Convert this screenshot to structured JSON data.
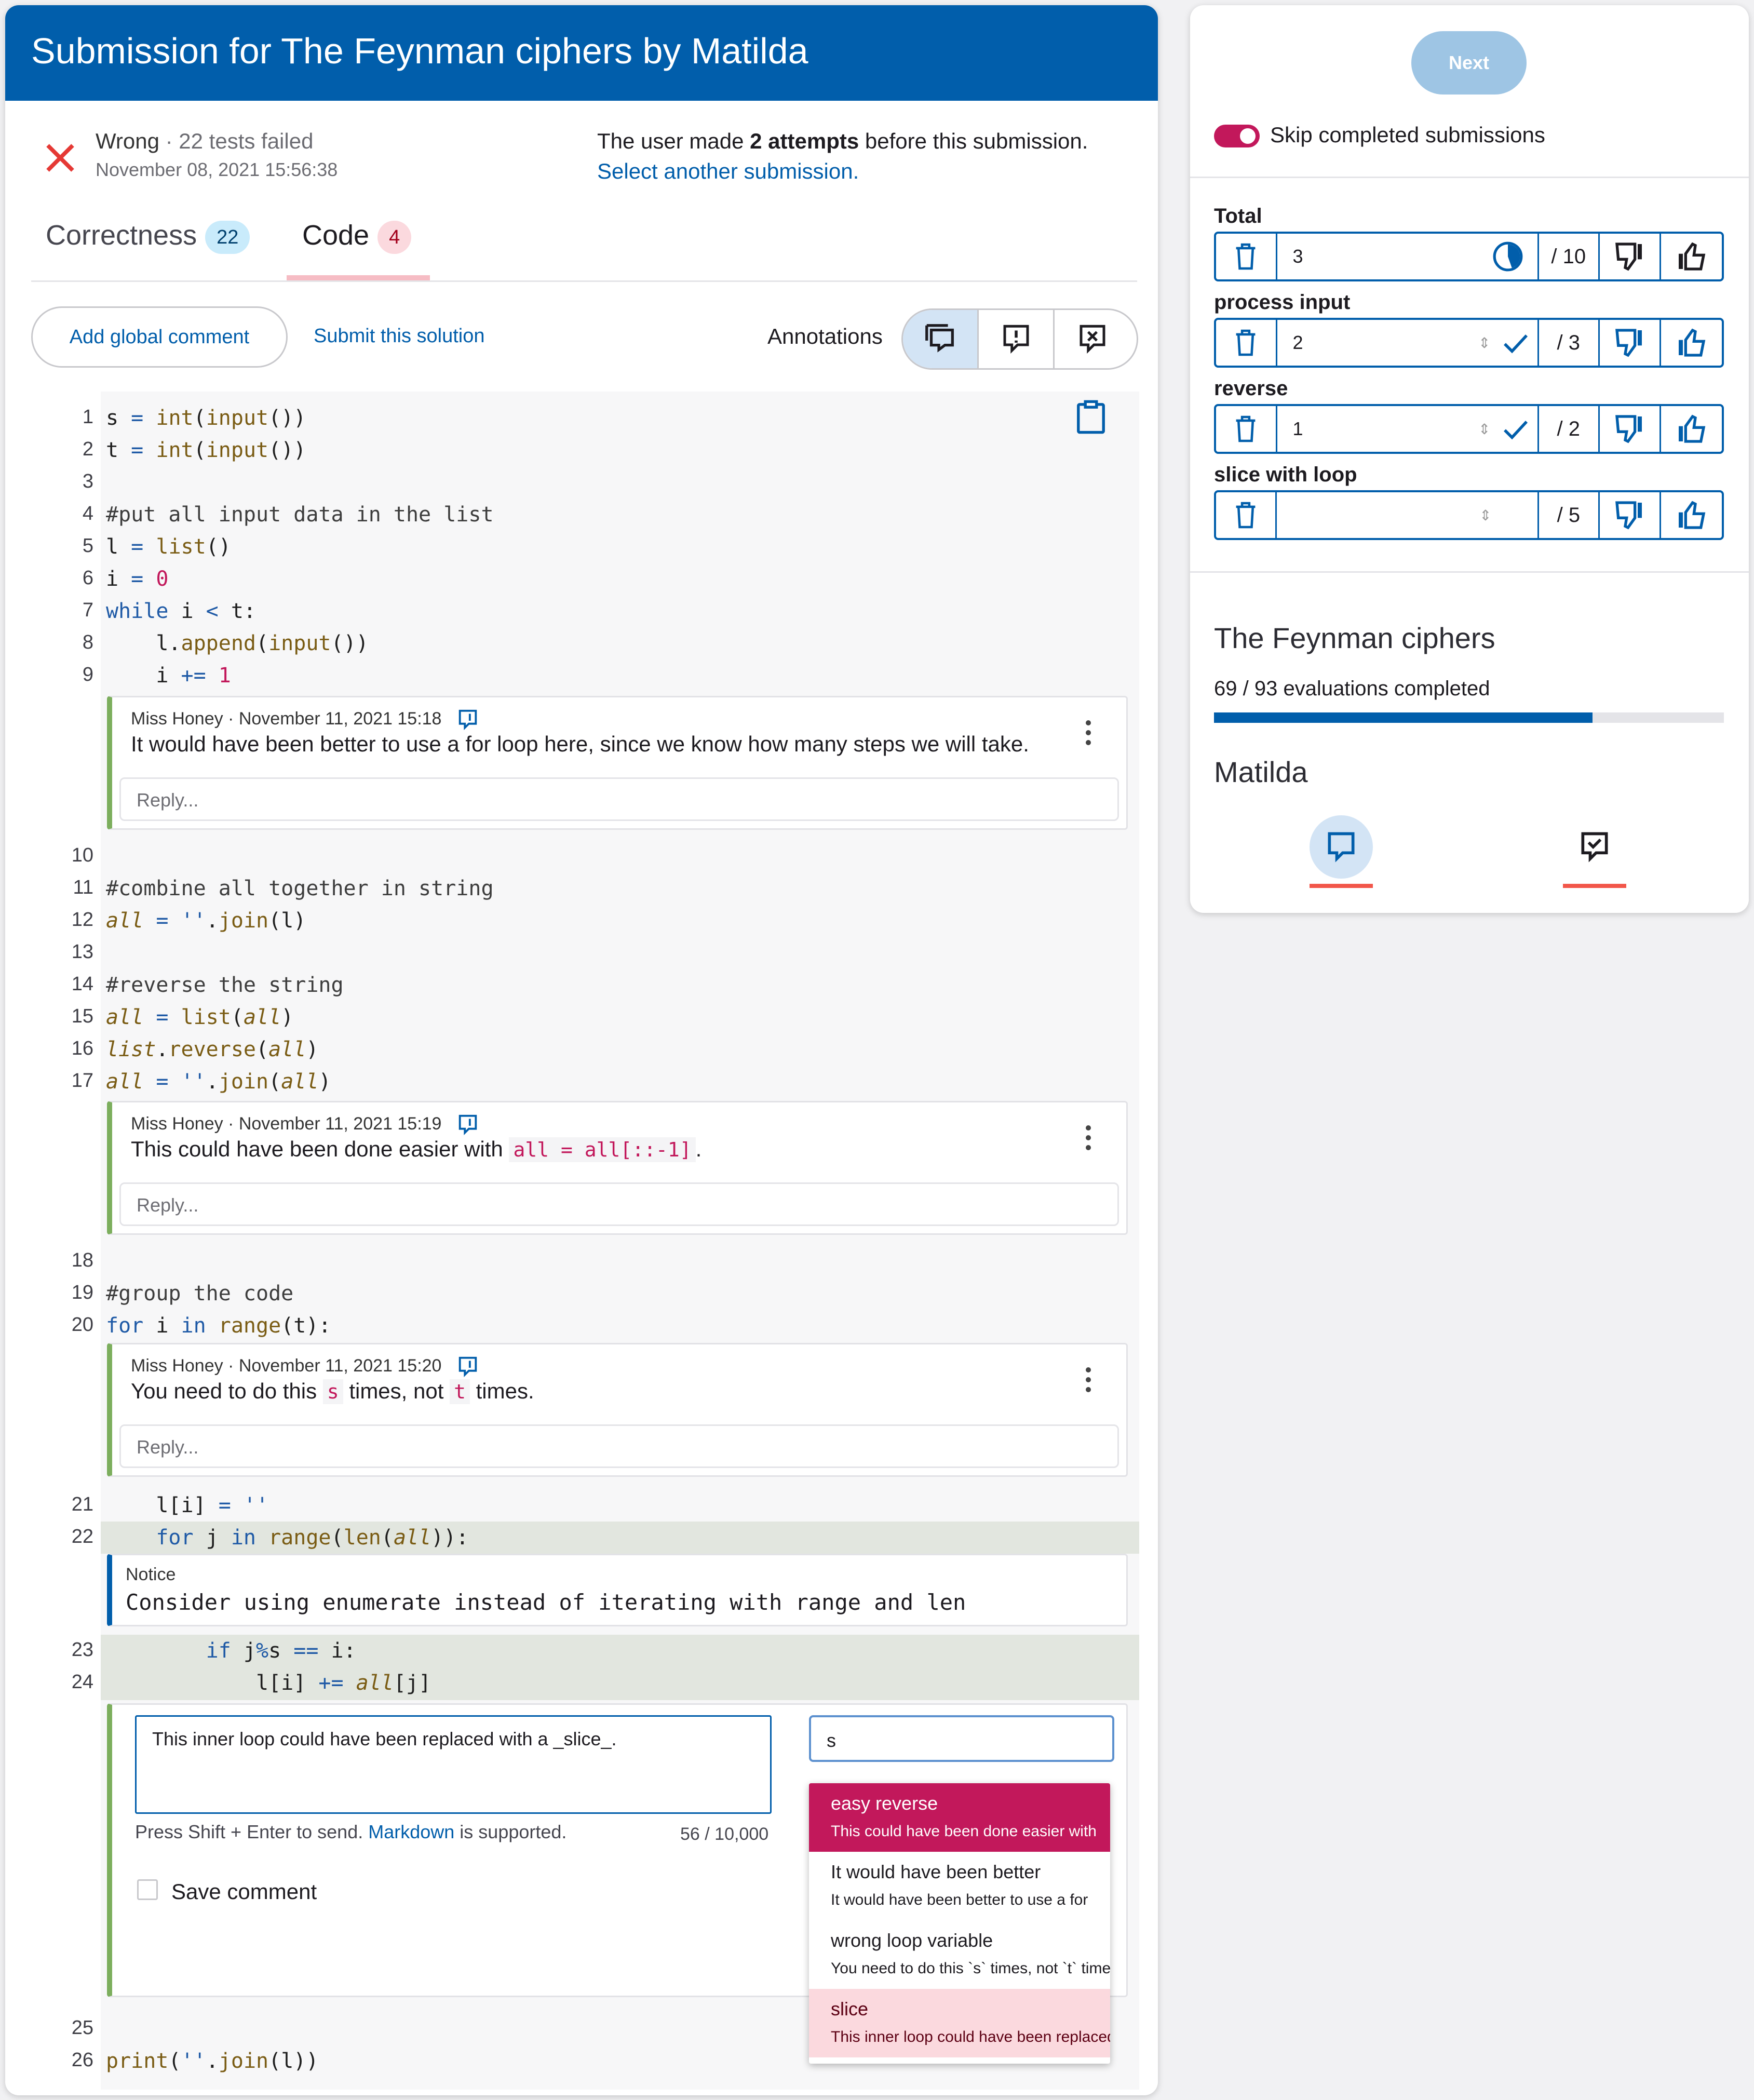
{
  "header": {
    "title": "Submission for The Feynman ciphers by Matilda"
  },
  "status": {
    "result": "Wrong",
    "tests_failed": "· 22 tests failed",
    "date": "November 08, 2021 15:56:38",
    "attempts_pre": "The user made ",
    "attempts_bold": "2 attempts",
    "attempts_post": " before this submission.",
    "select_link": "Select another submission."
  },
  "tabs": [
    {
      "label": "Correctness",
      "count": "22"
    },
    {
      "label": "Code",
      "count": "4"
    }
  ],
  "toolbar": {
    "add_global": "Add global comment",
    "submit": "Submit this solution",
    "annotations_label": "Annotations"
  },
  "line_numbers": [
    "1",
    "2",
    "3",
    "4",
    "5",
    "6",
    "7",
    "8",
    "9",
    "10",
    "11",
    "12",
    "13",
    "14",
    "15",
    "16",
    "17",
    "18",
    "19",
    "20",
    "21",
    "22",
    "23",
    "24",
    "25",
    "26"
  ],
  "annotations": [
    {
      "author": "Miss Honey · November 11, 2021 15:18",
      "text": "It would have been better to use a for loop here, since we know how many steps we will take.",
      "reply": "Reply..."
    },
    {
      "author": "Miss Honey · November 11, 2021 15:19",
      "text_pre": "This could have been done easier with ",
      "text_code": "all = all[::-1]",
      "text_post": ".",
      "reply": "Reply..."
    },
    {
      "author": "Miss Honey · November 11, 2021 15:20",
      "text_pre": "You need to do this ",
      "code1": "s",
      "text_mid": " times, not ",
      "code2": "t",
      "text_post": " times.",
      "reply": "Reply..."
    }
  ],
  "notice": {
    "title": "Notice",
    "text": "Consider using enumerate instead of iterating with range and len"
  },
  "editor": {
    "text": "This inner loop could have been replaced with a _slice_.",
    "hint_pre": "Press Shift + Enter to send. ",
    "hint_link": "Markdown",
    "hint_post": " is supported.",
    "counter": "56 / 10,000",
    "save_label": "Save comment",
    "search_value": "s"
  },
  "saved_comments": [
    {
      "title": "easy reverse",
      "preview": "This could have been done easier with"
    },
    {
      "title": "It would have been better",
      "preview": "It would have been better to use a for"
    },
    {
      "title": "wrong loop variable",
      "preview": "You need to do this `s` times, not `t` times"
    },
    {
      "title": "slice",
      "preview": "This inner loop could have been replaced"
    }
  ],
  "sidebar": {
    "next": "Next",
    "skip_label": "Skip completed submissions",
    "rubrics": [
      {
        "name": "Total",
        "value": "3",
        "max": "/ 10"
      },
      {
        "name": "process input",
        "value": "2",
        "max": "/ 3"
      },
      {
        "name": "reverse",
        "value": "1",
        "max": "/ 2"
      },
      {
        "name": "slice with loop",
        "value": "",
        "max": "/ 5"
      }
    ],
    "exercise": "The Feynman ciphers",
    "progress_text": "69 / 93 evaluations completed",
    "progress": 0.742,
    "user": "Matilda"
  },
  "colors": {
    "primary": "#015eab",
    "wrong": "#e53935",
    "comment_border": "#7cae5d",
    "selected_option": "#c2185b",
    "highlight_option": "#fbd9de"
  }
}
